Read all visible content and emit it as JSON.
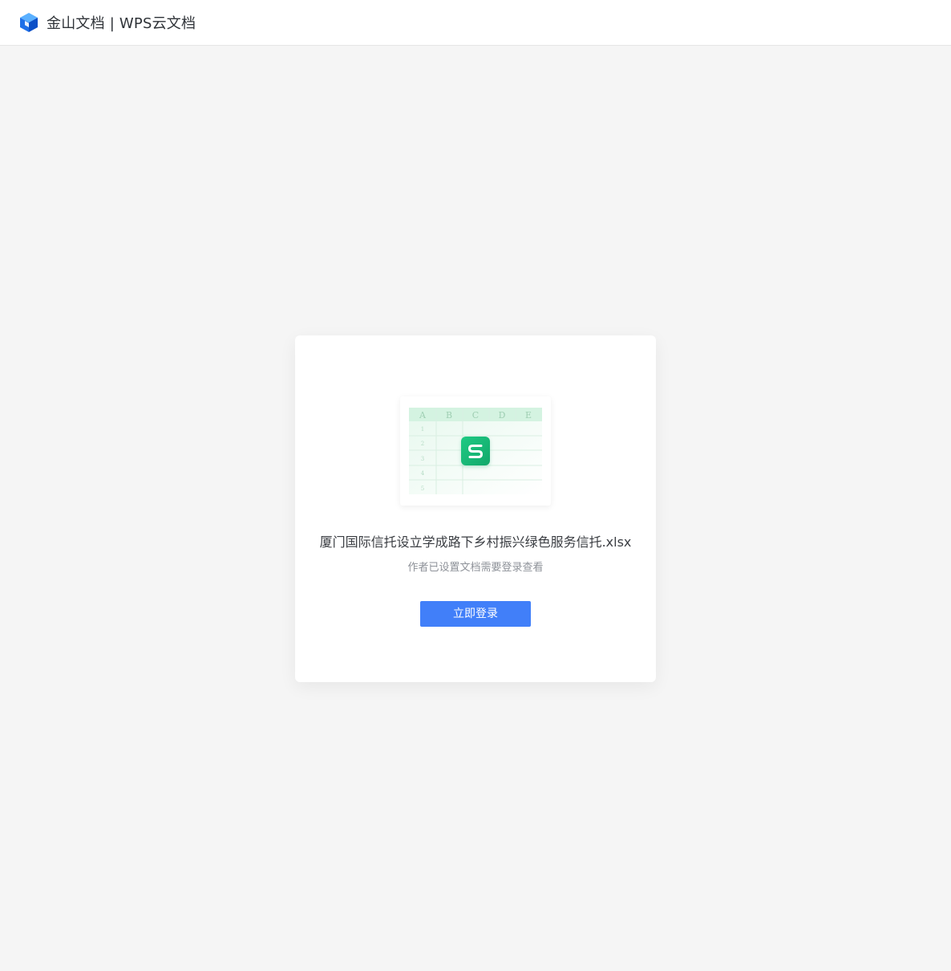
{
  "header": {
    "brand_title": "金山文档 | WPS云文档",
    "logo_icon": "wps-cube-logo-icon"
  },
  "card": {
    "preview": {
      "column_headers": [
        "A",
        "B",
        "C",
        "D",
        "E"
      ],
      "row_numbers": [
        "1",
        "2",
        "3",
        "4",
        "5"
      ],
      "app_icon": "wps-spreadsheet-icon"
    },
    "file_name": "厦门国际信托设立学成路下乡村振兴绿色服务信托.xlsx",
    "hint": "作者已设置文档需要登录查看",
    "login_label": "立即登录"
  },
  "colors": {
    "accent": "#417ff9",
    "spreadsheet_green": "#1fb776",
    "background": "#f5f5f5"
  }
}
